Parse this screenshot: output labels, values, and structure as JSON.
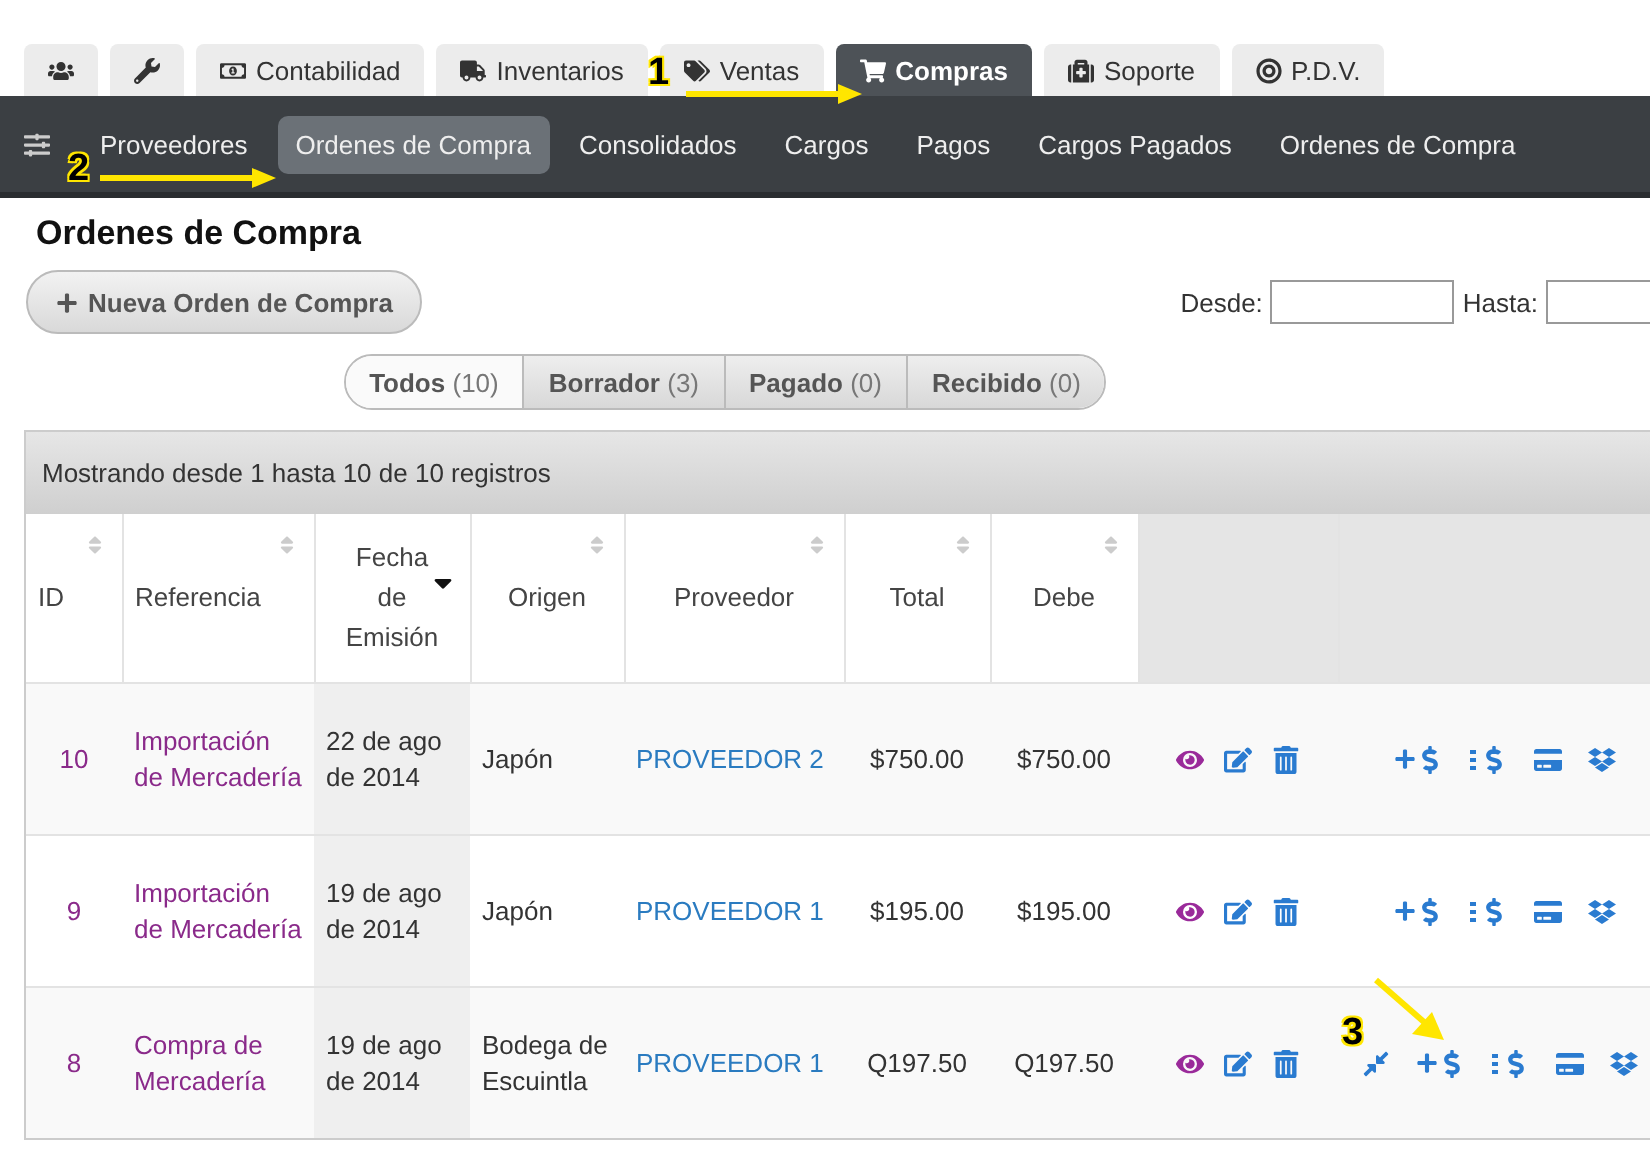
{
  "top_tabs": [
    {
      "kind": "users",
      "selected": false
    },
    {
      "kind": "wrench",
      "selected": false
    },
    {
      "kind": "money",
      "label": "Contabilidad",
      "selected": false
    },
    {
      "kind": "truck",
      "label": "Inventarios",
      "selected": false
    },
    {
      "kind": "tags",
      "label": "Ventas",
      "selected": false
    },
    {
      "kind": "cart",
      "label": "Compras",
      "selected": true
    },
    {
      "kind": "medkit",
      "label": "Soporte",
      "selected": false
    },
    {
      "kind": "target",
      "label": "P.D.V.",
      "selected": false
    }
  ],
  "nav": [
    {
      "label": "Proveedores",
      "selected": false
    },
    {
      "label": "Ordenes de Compra",
      "selected": true
    },
    {
      "label": "Consolidados",
      "selected": false
    },
    {
      "label": "Cargos",
      "selected": false
    },
    {
      "label": "Pagos",
      "selected": false
    },
    {
      "label": "Cargos Pagados",
      "selected": false
    },
    {
      "label": "Ordenes de Compra",
      "selected": false
    }
  ],
  "page_title": "Ordenes de Compra",
  "new_button": "Nueva Orden de Compra",
  "date_filter": {
    "from_label": "Desde:",
    "to_label": "Hasta:"
  },
  "status_filter": [
    {
      "label": "Todos",
      "count": "(10)",
      "selected": true
    },
    {
      "label": "Borrador",
      "count": "(3)",
      "selected": false
    },
    {
      "label": "Pagado",
      "count": "(0)",
      "selected": false
    },
    {
      "label": "Recibido",
      "count": "(0)",
      "selected": false
    }
  ],
  "table": {
    "info": "Mostrando desde 1 hasta 10 de 10 registros",
    "columns": [
      {
        "label": "ID",
        "sorted": false
      },
      {
        "label": "Referencia",
        "sorted": false
      },
      {
        "label": "Fecha de Emisión",
        "sorted": true
      },
      {
        "label": "Origen",
        "sorted": false
      },
      {
        "label": "Proveedor",
        "sorted": false
      },
      {
        "label": "Total",
        "sorted": false
      },
      {
        "label": "Debe",
        "sorted": false
      }
    ],
    "rows": [
      {
        "id": "10",
        "reference": "Importación de Mercadería",
        "date": "22 de ago de 2014",
        "origin": "Japón",
        "supplier": "PROVEEDOR 2",
        "total": "$750.00",
        "due": "$750.00",
        "tools": [
          {
            "kind": "view"
          },
          {
            "kind": "edit"
          },
          {
            "kind": "delete"
          }
        ],
        "payment_tools": [
          {
            "kind": "add-payment"
          },
          {
            "kind": "payments"
          },
          {
            "kind": "card"
          },
          {
            "kind": "box"
          }
        ]
      },
      {
        "id": "9",
        "reference": "Importación de Mercadería",
        "date": "19 de ago de 2014",
        "origin": "Japón",
        "supplier": "PROVEEDOR 1",
        "total": "$195.00",
        "due": "$195.00",
        "tools": [
          {
            "kind": "view"
          },
          {
            "kind": "edit"
          },
          {
            "kind": "delete"
          }
        ],
        "payment_tools": [
          {
            "kind": "add-payment"
          },
          {
            "kind": "payments"
          },
          {
            "kind": "card"
          },
          {
            "kind": "box"
          }
        ]
      },
      {
        "id": "8",
        "reference": "Compra de Mercadería",
        "date": "19 de ago de 2014",
        "origin": "Bodega de Escuintla",
        "supplier": "PROVEEDOR 1",
        "total": "Q197.50",
        "due": "Q197.50",
        "tools": [
          {
            "kind": "view"
          },
          {
            "kind": "edit"
          },
          {
            "kind": "delete"
          }
        ],
        "payment_tools": [
          {
            "kind": "merge"
          },
          {
            "kind": "add-payment"
          },
          {
            "kind": "payments"
          },
          {
            "kind": "card"
          },
          {
            "kind": "box"
          }
        ]
      }
    ]
  },
  "annotations": [
    {
      "label": "1"
    },
    {
      "label": "2"
    },
    {
      "label": "3"
    }
  ]
}
